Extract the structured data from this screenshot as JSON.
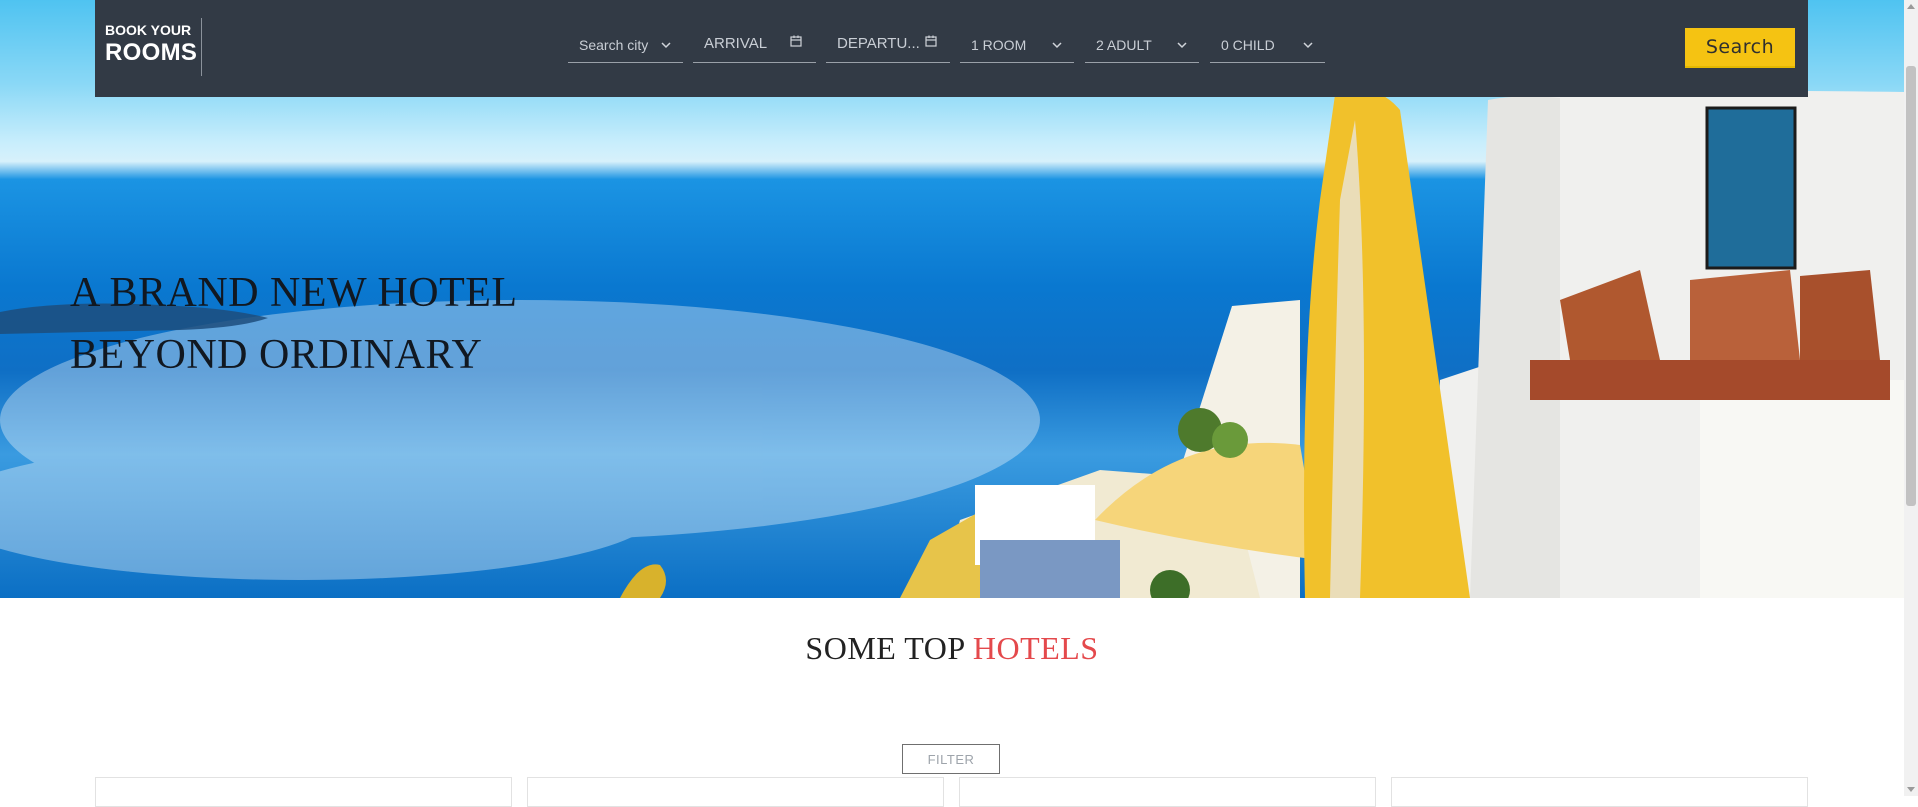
{
  "brand": {
    "line1": "BOOK YOUR",
    "line2": "ROOMS"
  },
  "booking_bar": {
    "city": {
      "label": "Search city"
    },
    "arrival": {
      "label": "ARRIVAL"
    },
    "departure": {
      "label": "DEPARTU..."
    },
    "rooms": {
      "label": "1 ROOM"
    },
    "adults": {
      "label": "2 ADULT"
    },
    "children": {
      "label": "0 CHILD"
    },
    "search_label": "Search"
  },
  "hero": {
    "title_line1": "A BRAND NEW HOTEL",
    "title_line2": "BEYOND ORDINARY"
  },
  "section": {
    "title_part1": "SOME TOP",
    "title_part2": "HOTELS",
    "filter_label": "FILTER"
  },
  "colors": {
    "navbar": "#323a45",
    "search_button": "#f5c312",
    "accent": "#e4494c"
  }
}
